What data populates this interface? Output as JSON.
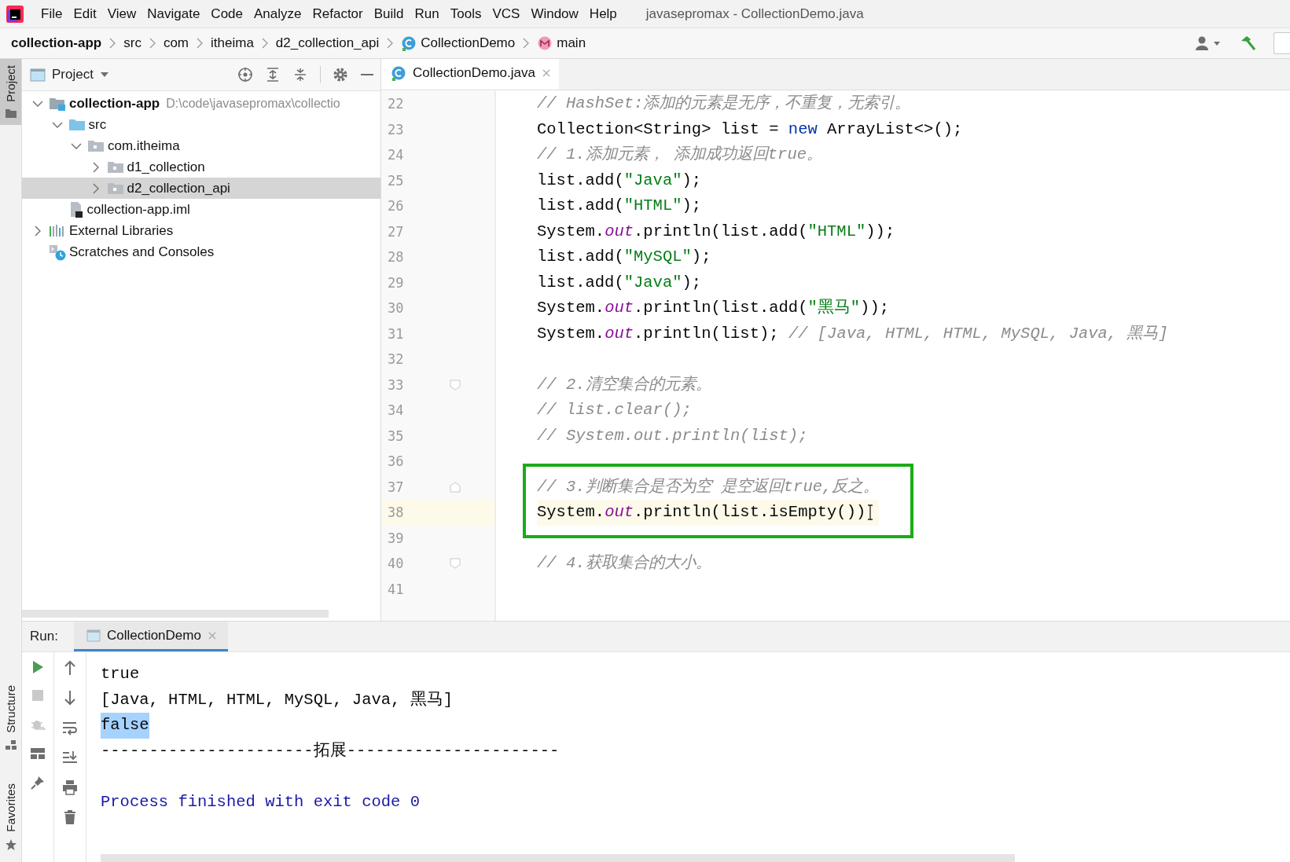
{
  "menu_bar": {
    "items": [
      "File",
      "Edit",
      "View",
      "Navigate",
      "Code",
      "Analyze",
      "Refactor",
      "Build",
      "Run",
      "Tools",
      "VCS",
      "Window",
      "Help"
    ],
    "title": "javasepromax - CollectionDemo.java"
  },
  "breadcrumbs": [
    {
      "label": "collection-app",
      "kind": "project"
    },
    {
      "label": "src",
      "kind": "folder"
    },
    {
      "label": "com",
      "kind": "folder"
    },
    {
      "label": "itheima",
      "kind": "folder"
    },
    {
      "label": "d2_collection_api",
      "kind": "folder"
    },
    {
      "label": "CollectionDemo",
      "kind": "class"
    },
    {
      "label": "main",
      "kind": "method"
    }
  ],
  "tool_strip": {
    "top": [
      {
        "label": "Project",
        "selected": true,
        "kind": "project"
      }
    ],
    "bottom": [
      {
        "label": "Structure",
        "selected": false,
        "kind": "structure"
      },
      {
        "label": "Favorites",
        "selected": false,
        "kind": "favorites"
      }
    ]
  },
  "project_panel": {
    "title": "Project",
    "tree": [
      {
        "label": "collection-app",
        "path": "D:\\code\\javasepromax\\collectio",
        "kind": "module",
        "expanded": true,
        "selected": false,
        "children": [
          {
            "label": "src",
            "kind": "source",
            "expanded": true,
            "selected": false,
            "children": [
              {
                "label": "com.itheima",
                "kind": "package",
                "expanded": true,
                "selected": false,
                "children": [
                  {
                    "label": "d1_collection",
                    "kind": "package",
                    "expanded": false,
                    "selected": false
                  },
                  {
                    "label": "d2_collection_api",
                    "kind": "package",
                    "expanded": false,
                    "selected": true
                  }
                ]
              }
            ]
          },
          {
            "label": "collection-app.iml",
            "kind": "iml",
            "selected": false
          }
        ]
      },
      {
        "label": "External Libraries",
        "kind": "libraries",
        "expanded": false,
        "selected": false
      },
      {
        "label": "Scratches and Consoles",
        "kind": "scratches",
        "selected": false
      }
    ]
  },
  "editor": {
    "tabs": [
      {
        "label": "CollectionDemo.java",
        "selected": true
      }
    ],
    "lines": [
      {
        "number": "22",
        "current": false,
        "boxed": false,
        "tokens": [
          {
            "kind": "comment",
            "text": "// HashSet:添加的元素是无序，不重复，无索引。"
          }
        ]
      },
      {
        "number": "23",
        "current": false,
        "boxed": false,
        "tokens": [
          {
            "kind": "plain",
            "text": "Collection<String> list = "
          },
          {
            "kind": "keyword",
            "text": "new"
          },
          {
            "kind": "plain",
            "text": " ArrayList<>();"
          }
        ]
      },
      {
        "number": "24",
        "current": false,
        "boxed": false,
        "tokens": [
          {
            "kind": "comment",
            "text": "// 1.添加元素， 添加成功返回true。"
          }
        ]
      },
      {
        "number": "25",
        "current": false,
        "boxed": false,
        "tokens": [
          {
            "kind": "plain",
            "text": "list.add("
          },
          {
            "kind": "string",
            "text": "\"Java\""
          },
          {
            "kind": "plain",
            "text": ");"
          }
        ]
      },
      {
        "number": "26",
        "current": false,
        "boxed": false,
        "tokens": [
          {
            "kind": "plain",
            "text": "list.add("
          },
          {
            "kind": "string",
            "text": "\"HTML\""
          },
          {
            "kind": "plain",
            "text": ");"
          }
        ]
      },
      {
        "number": "27",
        "current": false,
        "boxed": false,
        "tokens": [
          {
            "kind": "plain",
            "text": "System."
          },
          {
            "kind": "field",
            "text": "out"
          },
          {
            "kind": "plain",
            "text": ".println(list.add("
          },
          {
            "kind": "string",
            "text": "\"HTML\""
          },
          {
            "kind": "plain",
            "text": "));"
          }
        ]
      },
      {
        "number": "28",
        "current": false,
        "boxed": false,
        "tokens": [
          {
            "kind": "plain",
            "text": "list.add("
          },
          {
            "kind": "string",
            "text": "\"MySQL\""
          },
          {
            "kind": "plain",
            "text": ");"
          }
        ]
      },
      {
        "number": "29",
        "current": false,
        "boxed": false,
        "tokens": [
          {
            "kind": "plain",
            "text": "list.add("
          },
          {
            "kind": "string",
            "text": "\"Java\""
          },
          {
            "kind": "plain",
            "text": ");"
          }
        ]
      },
      {
        "number": "30",
        "current": false,
        "boxed": false,
        "tokens": [
          {
            "kind": "plain",
            "text": "System."
          },
          {
            "kind": "field",
            "text": "out"
          },
          {
            "kind": "plain",
            "text": ".println(list.add("
          },
          {
            "kind": "string",
            "text": "\"黑马\""
          },
          {
            "kind": "plain",
            "text": "));"
          }
        ]
      },
      {
        "number": "31",
        "current": false,
        "boxed": false,
        "tokens": [
          {
            "kind": "plain",
            "text": "System."
          },
          {
            "kind": "field",
            "text": "out"
          },
          {
            "kind": "plain",
            "text": ".println(list); "
          },
          {
            "kind": "comment",
            "text": "// [Java, HTML, HTML, MySQL, Java, 黑马]"
          }
        ]
      },
      {
        "number": "32",
        "current": false,
        "boxed": false
      },
      {
        "number": "33",
        "current": false,
        "boxed": false,
        "kind": "fold-start",
        "tokens": [
          {
            "kind": "comment",
            "text": "// 2.清空集合的元素。"
          }
        ]
      },
      {
        "number": "34",
        "current": false,
        "boxed": false,
        "tokens": [
          {
            "kind": "comment",
            "text": "// list.clear();"
          }
        ]
      },
      {
        "number": "35",
        "current": false,
        "boxed": false,
        "tokens": [
          {
            "kind": "comment",
            "text": "// System.out.println(list);"
          }
        ]
      },
      {
        "number": "36",
        "current": false,
        "boxed": false
      },
      {
        "number": "37",
        "current": false,
        "boxed": true,
        "kind": "fold-end",
        "tokens": [
          {
            "kind": "comment",
            "text": "// 3.判断集合是否为空 是空返回true,反之。"
          }
        ]
      },
      {
        "number": "38",
        "current": true,
        "boxed": true,
        "tokens": [
          {
            "kind": "plain",
            "text": "System."
          },
          {
            "kind": "field",
            "text": "out"
          },
          {
            "kind": "plain",
            "text": ".println(list.isEmpty())"
          }
        ]
      },
      {
        "number": "39",
        "current": false,
        "boxed": false
      },
      {
        "number": "40",
        "current": false,
        "boxed": false,
        "kind": "fold-start",
        "tokens": [
          {
            "kind": "comment",
            "text": "// 4.获取集合的大小。"
          }
        ]
      },
      {
        "number": "41",
        "current": false,
        "boxed": false
      }
    ]
  },
  "run_panel": {
    "label": "Run:",
    "tabs": [
      {
        "label": "CollectionDemo",
        "selected": true
      }
    ],
    "console": [
      {
        "text": "true",
        "kind": "output",
        "selected": false
      },
      {
        "text": "[Java, HTML, HTML, MySQL, Java, 黑马]",
        "kind": "output",
        "selected": false
      },
      {
        "text": "false",
        "kind": "output",
        "selected": true
      },
      {
        "text": "----------------------拓展----------------------",
        "kind": "output",
        "selected": false
      },
      {
        "text": "Process finished with exit code 0",
        "kind": "system",
        "selected": false
      }
    ]
  }
}
